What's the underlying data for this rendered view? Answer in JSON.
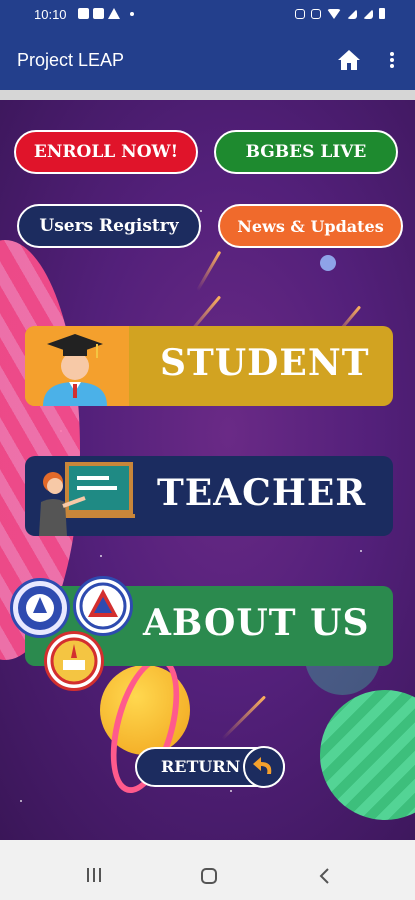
{
  "status_bar": {
    "time": "10:10"
  },
  "app_bar": {
    "title": "Project LEAP"
  },
  "menu": {
    "enroll_now": "ENROLL NOW!",
    "bgbes_live": "BGBES LIVE",
    "users_registry": "Users Registry",
    "news_updates": "News & Updates"
  },
  "cards": {
    "student": "STUDENT",
    "teacher": "TEACHER",
    "about": "ABOUT US"
  },
  "return_button": {
    "label": "RETURN"
  },
  "colors": {
    "app_bar": "#233f8c",
    "enroll": "#e0142a",
    "bgbes": "#1e8a2f",
    "registry": "#1c2c5f",
    "news": "#f06a2c",
    "student": "#d2a321",
    "teacher": "#1b2c60",
    "about": "#2b8a4e"
  },
  "icons": {
    "home": "home-icon",
    "more": "more-vert-icon",
    "return": "return-arrow-icon",
    "nav_recent": "recent-apps-icon",
    "nav_home": "nav-home-icon",
    "nav_back": "back-icon"
  }
}
